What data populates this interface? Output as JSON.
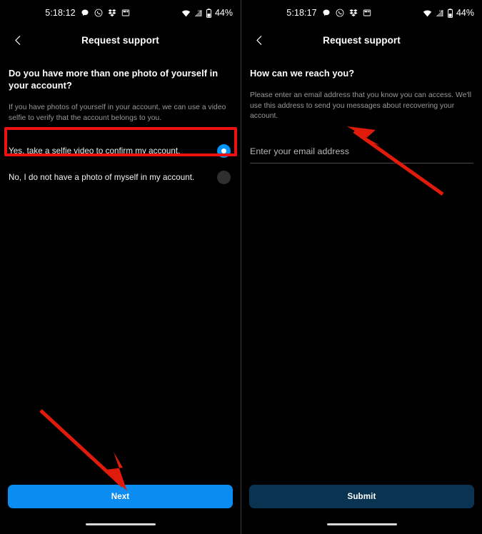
{
  "screens": [
    {
      "id": "screen-photo-question",
      "status_bar": {
        "time": "5:18:12",
        "battery_text": "44%",
        "icons": [
          "chat-bubble-icon",
          "whatsapp-icon",
          "dropbox-icon",
          "widget-icon",
          "wifi-icon",
          "signal-hd-icon",
          "battery-icon"
        ]
      },
      "header": {
        "title": "Request support",
        "back_icon": "chevron-left-icon"
      },
      "question": {
        "title": "Do you have more than one photo of yourself in your account?",
        "subtitle": "If you have photos of yourself in your account, we can use a video selfie to verify that the account belongs to you."
      },
      "options": [
        {
          "label": "Yes, take a selfie video to confirm my account.",
          "selected": true
        },
        {
          "label": "No, I do not have a photo of myself in my account.",
          "selected": false
        }
      ],
      "cta": {
        "label": "Next",
        "state": "enabled"
      }
    },
    {
      "id": "screen-contact-email",
      "status_bar": {
        "time": "5:18:17",
        "battery_text": "44%",
        "icons": [
          "chat-bubble-icon",
          "whatsapp-icon",
          "dropbox-icon",
          "widget-icon",
          "wifi-icon",
          "signal-hd-icon",
          "battery-icon"
        ]
      },
      "header": {
        "title": "Request support",
        "back_icon": "chevron-left-icon"
      },
      "question": {
        "title": "How can we reach you?",
        "subtitle": "Please enter an email address that you know you can access. We'll use this address to send you messages about recovering your account."
      },
      "email_field": {
        "value": "",
        "placeholder": "Enter your email address"
      },
      "cta": {
        "label": "Submit",
        "state": "disabled"
      }
    }
  ],
  "annotations": {
    "highlight_color": "#ee1111",
    "arrow_color": "#e01b0c"
  },
  "colors": {
    "background": "#000000",
    "accent_blue": "#0a8cf0",
    "radio_selected": "#0095f6",
    "radio_unselected": "#2f2f2f",
    "disabled_button": "#0a3251",
    "muted_text": "#9a9a9a"
  }
}
